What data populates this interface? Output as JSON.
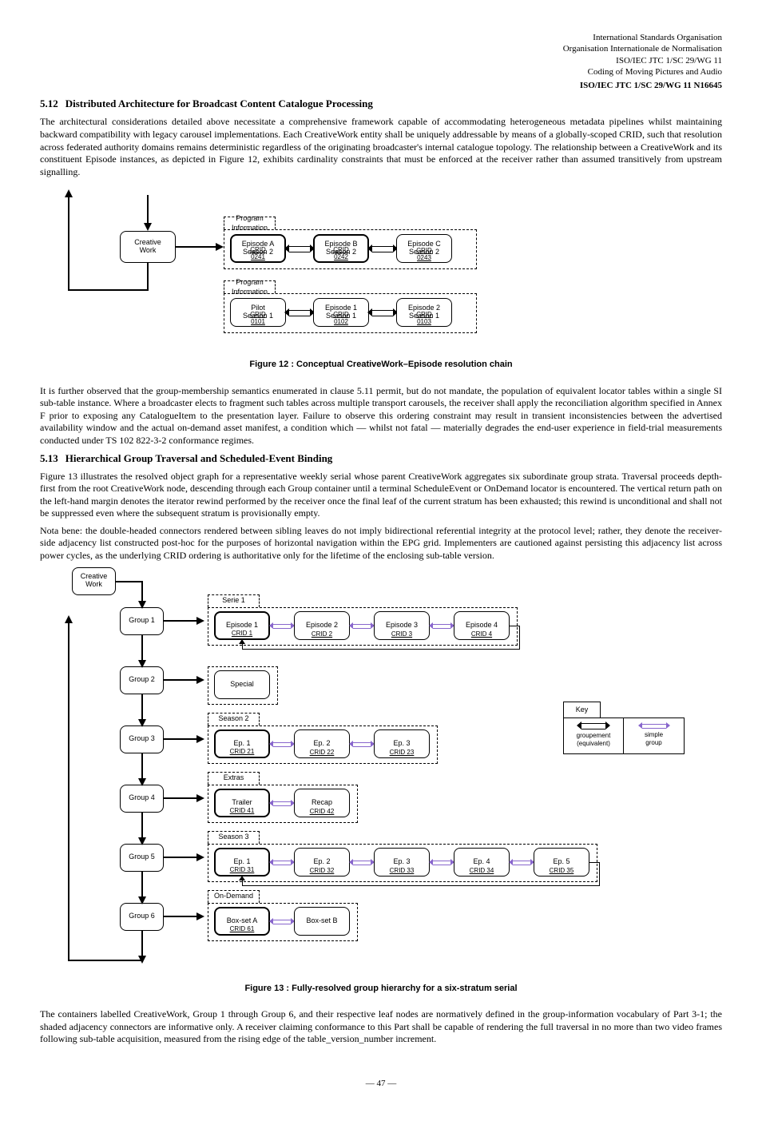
{
  "header": {
    "doc_line1": "International Standards Organisation",
    "doc_line2": "Organisation Internationale de Normalisation",
    "doc_line3": "ISO/IEC JTC 1/SC 29/WG 11",
    "doc_line4": "Coding of Moving Pictures and Audio",
    "doc_id": "ISO/IEC JTC 1/SC 29/WG 11 N16645"
  },
  "section1": {
    "number": "5.12",
    "title": "Distributed Architecture for Broadcast Content Catalogue Processing",
    "para1": "The architectural considerations detailed above necessitate a comprehensive framework capable of accommodating heterogeneous metadata pipelines whilst maintaining backward compatibility with legacy carousel implementations. Each CreativeWork entity shall be uniquely addressable by means of a globally-scoped CRID, such that resolution across federated authority domains remains deterministic regardless of the originating broadcaster's internal catalogue topology. The relationship between a CreativeWork and its constituent Episode instances, as depicted in Figure 12, exhibits cardinality constraints that must be enforced at the receiver rather than assumed transitively from upstream signalling."
  },
  "fig12": {
    "caption": "Figure 12 : Conceptual CreativeWork–Episode resolution chain",
    "creative_work": "Creative\nWork",
    "program_info": "Program\nInformation",
    "group1_label": "Program Information",
    "ep_a": {
      "text": "Episode A\nSeason 2",
      "id": "CRID 0241"
    },
    "ep_b": {
      "text": "Episode B\nSeason 2",
      "id": "CRID 0242"
    },
    "ep_c": {
      "text": "Episode C\nSeason 2",
      "id": "CRID 0243"
    },
    "group2_label": "Program Information",
    "s1_a": {
      "text": "Pilot\nSeason 1",
      "id": "CRID 0101"
    },
    "s1_b": {
      "text": "Episode 1\nSeason 1",
      "id": "CRID 0102"
    },
    "s1_c": {
      "text": "Episode 2\nSeason 1",
      "id": "CRID 0103"
    }
  },
  "section1b": {
    "para2": "It is further observed that the group-membership semantics enumerated in clause 5.11 permit, but do not mandate, the population of equivalent locator tables within a single SI sub-table instance. Where a broadcaster elects to fragment such tables across multiple transport carousels, the receiver shall apply the reconciliation algorithm specified in Annex F prior to exposing any CatalogueItem to the presentation layer. Failure to observe this ordering constraint may result in transient inconsistencies between the advertised availability window and the actual on-demand asset manifest, a condition which — whilst not fatal — materially degrades the end-user experience in field-trial measurements conducted under TS 102 822-3-2 conformance regimes."
  },
  "section2": {
    "number": "5.13",
    "title": "Hierarchical Group Traversal and Scheduled-Event Binding",
    "para1": "Figure 13 illustrates the resolved object graph for a representative weekly serial whose parent CreativeWork aggregates six subordinate group strata. Traversal proceeds depth-first from the root CreativeWork node, descending through each Group container until a terminal ScheduleEvent or OnDemand locator is encountered. The vertical return path on the left-hand margin denotes the iterator rewind performed by the receiver once the final leaf of the current stratum has been exhausted; this rewind is unconditional and shall not be suppressed even where the subsequent stratum is provisionally empty.",
    "para2": "Nota bene: the double-headed connectors rendered between sibling leaves do not imply bidirectional referential integrity at the protocol level; rather, they denote the receiver-side adjacency list constructed post-hoc for the purposes of horizontal navigation within the EPG grid. Implementers are cautioned against persisting this adjacency list across power cycles, as the underlying CRID ordering is authoritative only for the lifetime of the enclosing sub-table version."
  },
  "fig13": {
    "caption": "Figure 13 : Fully-resolved group hierarchy for a six-stratum serial",
    "cw": "Creative\nWork",
    "groups": [
      {
        "label": "Group 1",
        "tab": "Serie 1",
        "leaves": [
          {
            "text": "Episode 1",
            "id": "CRID 1"
          },
          {
            "text": "Episode 2",
            "id": "CRID 2"
          },
          {
            "text": "Episode 3",
            "id": "CRID 3"
          },
          {
            "text": "Episode 4",
            "id": "CRID 4"
          }
        ],
        "wrap": true
      },
      {
        "label": "Group 2",
        "tab": "",
        "leaves": [
          {
            "text": "Special",
            "id": ""
          }
        ],
        "wrap": false
      },
      {
        "label": "Group 3",
        "tab": "Season 2",
        "leaves": [
          {
            "text": "Ep. 1",
            "id": "CRID 21"
          },
          {
            "text": "Ep. 2",
            "id": "CRID 22"
          },
          {
            "text": "Ep. 3",
            "id": "CRID 23"
          }
        ],
        "wrap": false
      },
      {
        "label": "Group 4",
        "tab": "Extras",
        "leaves": [
          {
            "text": "Trailer",
            "id": "CRID 41"
          },
          {
            "text": "Recap",
            "id": "CRID 42"
          }
        ],
        "wrap": false
      },
      {
        "label": "Group 5",
        "tab": "Season 3",
        "leaves": [
          {
            "text": "Ep. 1",
            "id": "CRID 31"
          },
          {
            "text": "Ep. 2",
            "id": "CRID 32"
          },
          {
            "text": "Ep. 3",
            "id": "CRID 33"
          },
          {
            "text": "Ep. 4",
            "id": "CRID 34"
          },
          {
            "text": "Ep. 5",
            "id": "CRID 35"
          }
        ],
        "wrap": true
      },
      {
        "label": "Group 6",
        "tab": "On-Demand",
        "leaves": [
          {
            "text": "Box-set A",
            "id": "CRID 61"
          },
          {
            "text": "Box-set B",
            "id": ""
          }
        ],
        "wrap": false
      }
    ],
    "legend": {
      "title": "Key",
      "left": "groupement\n(equivalent)",
      "right": "simple\ngroup"
    }
  },
  "closing": {
    "para": "The containers labelled CreativeWork, Group 1 through Group 6, and their respective leaf nodes are normatively defined in the group-information vocabulary of Part 3-1; the shaded adjacency connectors are informative only. A receiver claiming conformance to this Part shall be capable of rendering the full traversal in no more than two video frames following sub-table acquisition, measured from the rising edge of the table_version_number increment."
  },
  "footer": "— 47 —"
}
